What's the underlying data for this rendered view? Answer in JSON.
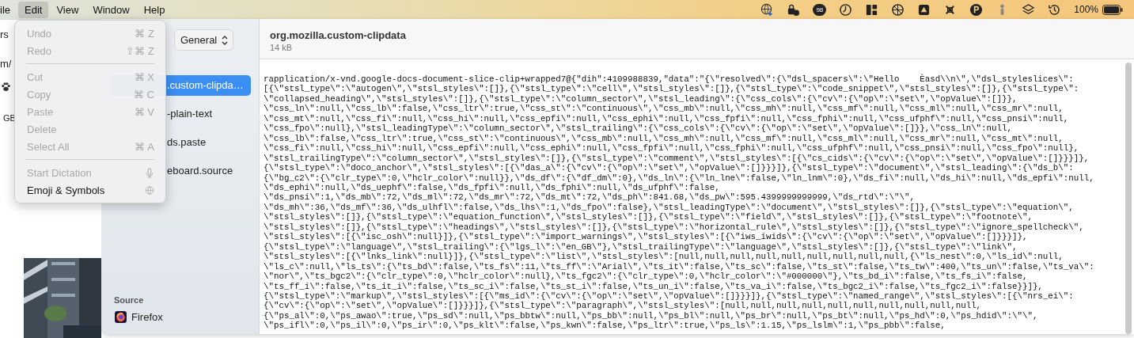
{
  "menu_bar": {
    "items": [
      {
        "label": "ile",
        "selected": false
      },
      {
        "label": "Edit",
        "selected": true
      },
      {
        "label": "View",
        "selected": false
      },
      {
        "label": "Window",
        "selected": false
      },
      {
        "label": "Help",
        "selected": false
      }
    ],
    "badge": "98",
    "battery": "100%"
  },
  "edit_menu": {
    "groups": [
      [
        {
          "label": "Undo",
          "kind": "shortcut",
          "shortcut": "⌘ Z",
          "disabled": true
        },
        {
          "label": "Redo",
          "kind": "shortcut",
          "shortcut": "⇧⌘ Z",
          "disabled": true
        }
      ],
      [
        {
          "label": "Cut",
          "kind": "shortcut",
          "shortcut": "⌘ X",
          "disabled": true
        },
        {
          "label": "Copy",
          "kind": "shortcut",
          "shortcut": "⌘ C",
          "disabled": true
        },
        {
          "label": "Paste",
          "kind": "shortcut",
          "shortcut": "⌘ V",
          "disabled": true
        },
        {
          "label": "Delete",
          "kind": "plain",
          "disabled": true
        },
        {
          "label": "Select All",
          "kind": "shortcut",
          "shortcut": "⌘ A",
          "disabled": true
        }
      ],
      [
        {
          "label": "Start Dictation",
          "kind": "dictation",
          "disabled": true
        },
        {
          "label": "Emoji & Symbols",
          "kind": "symbols",
          "disabled": false
        }
      ]
    ]
  },
  "background_window": {
    "fragments": [
      "rs",
      "m/",
      "GB"
    ]
  },
  "sidebar": {
    "popup": "General",
    "items": [
      {
        "label": ".custom-clipda…",
        "selected": true
      },
      {
        "label": "-plain-text",
        "selected": false
      },
      {
        "label": "ds.paste",
        "selected": false
      },
      {
        "label": "eboard.source",
        "selected": false
      }
    ],
    "source_heading": "Source",
    "source": "Firefox"
  },
  "content": {
    "title": "org.mozilla.custom-clipdata",
    "size": "14 kB",
    "lines": [
      "rapplication/x-vnd.google-docs-document-slice-clip+wrapped7@{\"dih\":4109988839,\"data\":\"{\\\"resolved\\\":{\\\"dsl_spacers\\\":\\\"Hello    Èasd\\\\n\\\",\\\"dsl_styleslices\\\":",
      "[{\\\"stsl_type\\\":\\\"autogen\\\",\\\"stsl_styles\\\":[]},{\\\"stsl_type\\\":\\\"cell\\\",\\\"stsl_styles\\\":[]},{\\\"stsl_type\\\":\\\"code_snippet\\\",\\\"stsl_styles\\\":[]},{\\\"stsl_type\\\":",
      "\\\"collapsed_heading\\\",\\\"stsl_styles\\\":[]},{\\\"stsl_type\\\":\\\"column_sector\\\",\\\"stsl_leading\\\":{\\\"css_cols\\\":{\\\"cv\\\":{\\\"op\\\":\\\"set\\\",\\\"opValue\\\":[]}},",
      "\\\"css_ln\\\":null,\\\"css_lb\\\":false,\\\"css_ltr\\\":true,\\\"css_st\\\":\\\"continuous\\\",\\\"css_mb\\\":null,\\\"css_mh\\\":null,\\\"css_mf\\\":null,\\\"css_ml\\\":null,\\\"css_mr\\\":null,",
      "\\\"css_mt\\\":null,\\\"css_fi\\\":null,\\\"css_hi\\\":null,\\\"css_epfi\\\":null,\\\"css_ephi\\\":null,\\\"css_fpfi\\\":null,\\\"css_fphi\\\":null,\\\"css_ufphf\\\":null,\\\"css_pnsi\\\":null,",
      "\\\"css_fpo\\\":null},\\\"stsl_leadingType\\\":\\\"column_sector\\\",\\\"stsl_trailing\\\":{\\\"css_cols\\\":{\\\"cv\\\":{\\\"op\\\":\\\"set\\\",\\\"opValue\\\":[]}},\\\"css_ln\\\":null,",
      "\\\"css_lb\\\":false,\\\"css_ltr\\\":true,\\\"css_st\\\":\\\"continuous\\\",\\\"css_mb\\\":null,\\\"css_mh\\\":null,\\\"css_mf\\\":null,\\\"css_ml\\\":null,\\\"css_mr\\\":null,\\\"css_mt\\\":null,",
      "\\\"css_fi\\\":null,\\\"css_hi\\\":null,\\\"css_epfi\\\":null,\\\"css_ephi\\\":null,\\\"css_fpfi\\\":null,\\\"css_fphi\\\":null,\\\"css_ufphf\\\":null,\\\"css_pnsi\\\":null,\\\"css_fpo\\\":null},",
      "\\\"stsl_trailingType\\\":\\\"column_sector\\\",\\\"stsl_styles\\\":[]},{\\\"stsl_type\\\":\\\"comment\\\",\\\"stsl_styles\\\":[{\\\"cs_cids\\\":{\\\"cv\\\":{\\\"op\\\":\\\"set\\\",\\\"opValue\\\":[]}}}]},",
      "{\\\"stsl_type\\\":\\\"doco_anchor\\\",\\\"stsl_styles\\\":[{\\\"das_a\\\":{\\\"cv\\\":{\\\"op\\\":\\\"set\\\",\\\"opValue\\\":[]}}}]},{\\\"stsl_type\\\":\\\"document\\\",\\\"stsl_leading\\\":{\\\"ds_b\\\":",
      "{\\\"bg_c2\\\":{\\\"clr_type\\\":0,\\\"hclr_color\\\":null}},\\\"ds_df\\\":{\\\"df_dm\\\":0},\\\"ds_ln\\\":{\\\"ln_lne\\\":false,\\\"ln_lnm\\\":0},\\\"ds_fi\\\":null,\\\"ds_hi\\\":null,\\\"ds_epfi\\\":null,",
      "\\\"ds_ephi\\\":null,\\\"ds_uephf\\\":false,\\\"ds_fpfi\\\":null,\\\"ds_fphi\\\":null,\\\"ds_ufphf\\\":false,",
      "\\\"ds_pnsi\\\":1,\\\"ds_mb\\\":72,\\\"ds_ml\\\":72,\\\"ds_mr\\\":72,\\\"ds_mt\\\":72,\\\"ds_ph\\\":841.68,\\\"ds_pw\\\":595.4399999999999,\\\"ds_rtd\\\":\\\"\\\",",
      "\\\"ds_mh\\\":36,\\\"ds_mf\\\":36,\\\"ds_ulhfl\\\":false,\\\"ds_lhs\\\":1,\\\"ds_fpo\\\":false},\\\"stsl_leadingType\\\":\\\"document\\\",\\\"stsl_styles\\\":[]},{\\\"stsl_type\\\":\\\"equation\\\",",
      "\\\"stsl_styles\\\":[]},{\\\"stsl_type\\\":\\\"equation_function\\\",\\\"stsl_styles\\\":[]},{\\\"stsl_type\\\":\\\"field\\\",\\\"stsl_styles\\\":[]},{\\\"stsl_type\\\":\\\"footnote\\\",",
      "\\\"stsl_styles\\\":[]},{\\\"stsl_type\\\":\\\"headings\\\",\\\"stsl_styles\\\":[]},{\\\"stsl_type\\\":\\\"horizontal_rule\\\",\\\"stsl_styles\\\":[]},{\\\"stsl_type\\\":\\\"ignore_spellcheck\\\",",
      "\\\"stsl_styles\\\":[{\\\"isc_osh\\\":null}]},{\\\"stsl_type\\\":\\\"import_warnings\\\",\\\"stsl_styles\\\":[{\\\"iws_iwids\\\":{\\\"cv\\\":{\\\"op\\\":\\\"set\\\",\\\"opValue\\\":[]}}}]},",
      "{\\\"stsl_type\\\":\\\"language\\\",\\\"stsl_trailing\\\":{\\\"lgs_l\\\":\\\"en_GB\\\"},\\\"stsl_trailingType\\\":\\\"language\\\",\\\"stsl_styles\\\":[]},{\\\"stsl_type\\\":\\\"link\\\",",
      "\\\"stsl_styles\\\":[{\\\"lnks_link\\\":null}]},{\\\"stsl_type\\\":\\\"list\\\",\\\"stsl_styles\\\":[null,null,null,null,null,null,null,null,null,{\\\"ls_nest\\\":0,\\\"ls_id\\\":null,",
      "\\\"ls_c\\\":null,\\\"ls_ts\\\":{\\\"ts_bd\\\":false,\\\"ts_fs\\\":11,\\\"ts_ff\\\":\\\"Arial\\\",\\\"ts_it\\\":false,\\\"ts_sc\\\":false,\\\"ts_st\\\":false,\\\"ts_tw\\\":400,\\\"ts_un\\\":false,\\\"ts_va\\\":",
      "\\\"nor\\\",\\\"ts_bgc2\\\":{\\\"clr_type\\\":0,\\\"hclr_color\\\":null},\\\"ts_fgc2\\\":{\\\"clr_type\\\":0,\\\"hclr_color\\\":\\\"#000000\\\"},\\\"ts_bd_i\\\":false,\\\"ts_fs_i\\\":false,",
      "\\\"ts_ff_i\\\":false,\\\"ts_it_i\\\":false,\\\"ts_sc_i\\\":false,\\\"ts_st_i\\\":false,\\\"ts_un_i\\\":false,\\\"ts_va_i\\\":false,\\\"ts_bgc2_i\\\":false,\\\"ts_fgc2_i\\\":false}}]},",
      "{\\\"stsl_type\\\":\\\"markup\\\",\\\"stsl_styles\\\":[{\\\"ms_id\\\":{\\\"cv\\\":{\\\"op\\\":\\\"set\\\",\\\"opValue\\\":[]}}}]},{\\\"stsl_type\\\":\\\"named_range\\\",\\\"stsl_styles\\\":[{\\\"nrs_ei\\\":",
      "{\\\"cv\\\":{\\\"op\\\":\\\"set\\\",\\\"opValue\\\":[]}}}]},{\\\"stsl_type\\\":\\\"paragraph\\\",\\\"stsl_styles\\\":[null,null,null,null,null,null,null,null,null,null,",
      "{\\\"ps_al\\\":0,\\\"ps_awao\\\":true,\\\"ps_sd\\\":null,\\\"ps_bbtw\\\":null,\\\"ps_bb\\\":null,\\\"ps_bl\\\":null,\\\"ps_br\\\":null,\\\"ps_bt\\\":null,\\\"ps_hd\\\":0,\\\"ps_hdid\\\":\\\"\\\",",
      "\\\"ps_ifl\\\":0,\\\"ps_il\\\":0,\\\"ps_ir\\\":0,\\\"ps_klt\\\":false,\\\"ps_kwn\\\":false,\\\"ps_ltr\\\":true,\\\"ps_ls\\\":1.15,\\\"ps_lslm\\\":1,\\\"ps_pbb\\\":false,"
    ]
  }
}
